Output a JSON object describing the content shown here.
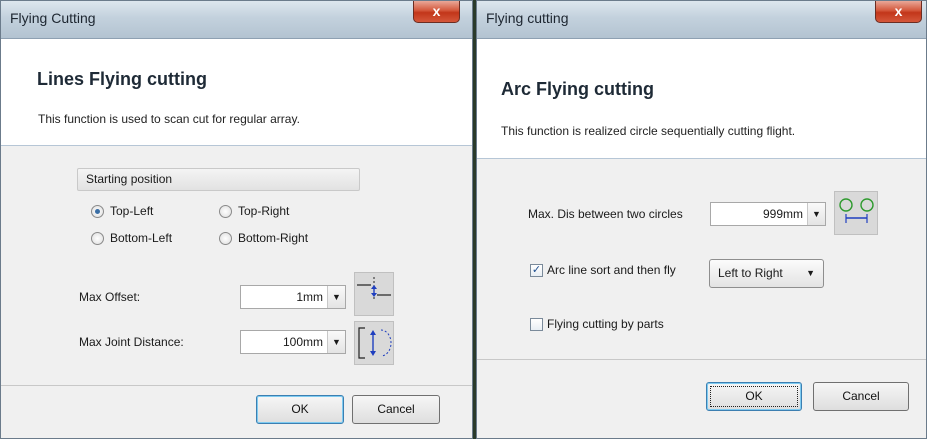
{
  "window_lines": {
    "title": "Flying Cutting",
    "close_label": "x",
    "header_title": "Lines Flying cutting",
    "header_desc": "This function is used to scan cut for regular array.",
    "group_label": "Starting position",
    "radios": [
      {
        "label": "Top-Left",
        "checked": true
      },
      {
        "label": "Top-Right",
        "checked": false
      },
      {
        "label": "Bottom-Left",
        "checked": false
      },
      {
        "label": "Bottom-Right",
        "checked": false
      }
    ],
    "max_offset_label": "Max Offset:",
    "max_offset_value": "1mm",
    "max_joint_label": "Max Joint Distance:",
    "max_joint_value": "100mm",
    "ok_label": "OK",
    "cancel_label": "Cancel"
  },
  "window_arc": {
    "title": "Flying cutting",
    "close_label": "x",
    "header_title": "Arc Flying cutting",
    "header_desc": "This function is realized circle sequentially cutting flight.",
    "max_dis_label": "Max. Dis between two circles",
    "max_dis_value": "999mm",
    "arc_sort_label": "Arc line sort and then fly",
    "arc_sort_checked": true,
    "direction_value": "Left to Right",
    "by_parts_label": "Flying cutting by parts",
    "by_parts_checked": false,
    "ok_label": "OK",
    "cancel_label": "Cancel"
  },
  "colors": {
    "accent": "#3c7fb1",
    "close_red": "#c2361a",
    "icon_green": "#2e9a2e",
    "icon_blue": "#1f3fbf"
  }
}
